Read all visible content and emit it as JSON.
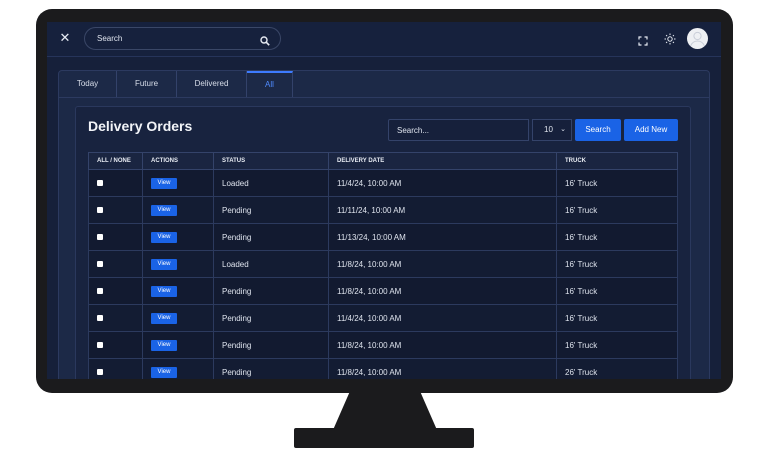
{
  "topbar": {
    "search_placeholder": "Search"
  },
  "tabs": [
    {
      "label": "Today"
    },
    {
      "label": "Future"
    },
    {
      "label": "Delivered"
    },
    {
      "label": "All",
      "active": true
    }
  ],
  "orders": {
    "title": "Delivery Orders",
    "search_placeholder": "Search...",
    "page_size": "10",
    "search_label": "Search",
    "add_label": "Add New",
    "columns": [
      "ALL / NONE",
      "ACTIONS",
      "STATUS",
      "DELIVERY DATE",
      "TRUCK"
    ],
    "view_label": "View",
    "rows": [
      {
        "status": "Loaded",
        "date": "11/4/24, 10:00 AM",
        "truck": "16' Truck"
      },
      {
        "status": "Pending",
        "date": "11/11/24, 10:00 AM",
        "truck": "16' Truck"
      },
      {
        "status": "Pending",
        "date": "11/13/24, 10:00 AM",
        "truck": "16' Truck"
      },
      {
        "status": "Loaded",
        "date": "11/8/24, 10:00 AM",
        "truck": "16' Truck"
      },
      {
        "status": "Pending",
        "date": "11/8/24, 10:00 AM",
        "truck": "16' Truck"
      },
      {
        "status": "Pending",
        "date": "11/4/24, 10:00 AM",
        "truck": "16' Truck"
      },
      {
        "status": "Pending",
        "date": "11/8/24, 10:00 AM",
        "truck": "16' Truck"
      },
      {
        "status": "Pending",
        "date": "11/8/24, 10:00 AM",
        "truck": "26' Truck"
      }
    ]
  },
  "colors": {
    "accent": "#1a63e6",
    "background": "#16203a",
    "monitor": "#1b1b1d"
  },
  "icons": [
    "close-icon",
    "search-icon",
    "fullscreen-icon",
    "sun-icon",
    "avatar-icon",
    "chevron-down-icon"
  ]
}
